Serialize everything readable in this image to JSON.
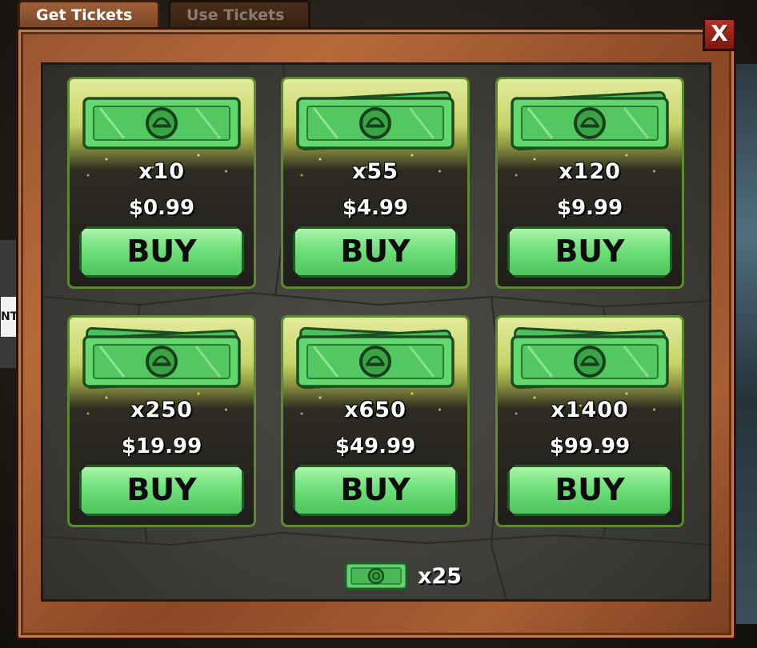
{
  "tabs": [
    {
      "label": "Get Tickets",
      "active": true
    },
    {
      "label": "Use Tickets",
      "active": false
    }
  ],
  "close_label": "X",
  "background_label": "NT",
  "packs": [
    {
      "quantity": "x10",
      "price": "$0.99",
      "buy_label": "BUY",
      "ticket_stack": 1
    },
    {
      "quantity": "x55",
      "price": "$4.99",
      "buy_label": "BUY",
      "ticket_stack": 2
    },
    {
      "quantity": "x120",
      "price": "$9.99",
      "buy_label": "BUY",
      "ticket_stack": 2
    },
    {
      "quantity": "x250",
      "price": "$19.99",
      "buy_label": "BUY",
      "ticket_stack": 3
    },
    {
      "quantity": "x650",
      "price": "$49.99",
      "buy_label": "BUY",
      "ticket_stack": 3
    },
    {
      "quantity": "x1400",
      "price": "$99.99",
      "buy_label": "BUY",
      "ticket_stack": 3
    }
  ],
  "balance": {
    "label": "x25",
    "icon": "ticket-icon"
  },
  "colors": {
    "ticket_green": "#5fd46a",
    "ticket_dark": "#2a7a31",
    "buy_green": "#6fe07a",
    "frame_wood": "#a95e33",
    "close_red": "#b53024"
  }
}
